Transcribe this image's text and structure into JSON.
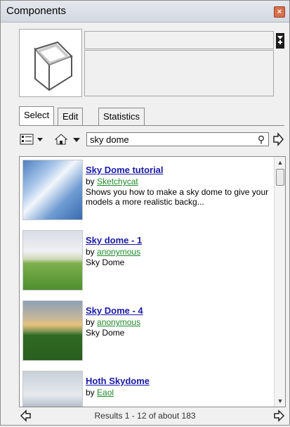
{
  "window": {
    "title": "Components",
    "close_label": "×"
  },
  "preview": {
    "name_value": "",
    "description_value": ""
  },
  "tabs": [
    {
      "label": "Select"
    },
    {
      "label": "Edit"
    },
    {
      "label": "Statistics"
    }
  ],
  "toolbar": {
    "view_options_icon": "list-view-icon",
    "home_icon": "home-icon",
    "navigation_dropdown_icon": "triangle-down-icon",
    "search_value": "sky dome",
    "search_icon": "magnifier-icon",
    "go_icon": "arrow-right-icon"
  },
  "results": [
    {
      "title": "Sky Dome tutorial",
      "by_prefix": "by",
      "author": "Sketchycat",
      "description": "Shows you how to make a sky dome to give your models a more realistic backg..."
    },
    {
      "title": "Sky dome - 1",
      "by_prefix": "by",
      "author": "anonymous",
      "description": "Sky Dome"
    },
    {
      "title": "Sky Dome - 4",
      "by_prefix": "by",
      "author": "anonymous",
      "description": "Sky Dome"
    },
    {
      "title": "Hoth Skydome",
      "by_prefix": "by",
      "author": "Eaol",
      "description": ""
    }
  ],
  "status": {
    "text": "Results 1 - 12 of about 183"
  },
  "colors": {
    "link_title": "#1a1aa6",
    "link_author": "#1f8a2a",
    "close_button": "#d9704c"
  }
}
